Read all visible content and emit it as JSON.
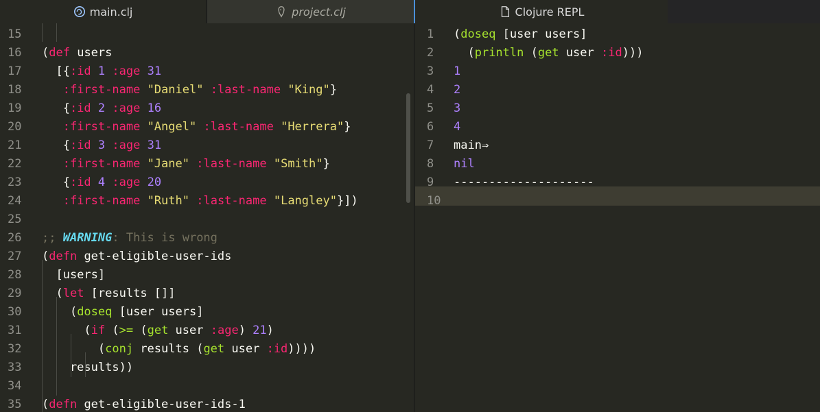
{
  "tabs": {
    "main": "main.clj",
    "project": "project.clj",
    "repl": "Clojure REPL"
  },
  "editor": {
    "lines": [
      {
        "n": "15",
        "tokens": []
      },
      {
        "n": "16",
        "tokens": [
          [
            "p",
            "("
          ],
          [
            "kw",
            "def"
          ],
          [
            "p",
            " users"
          ]
        ]
      },
      {
        "n": "17",
        "tokens": [
          [
            "p",
            "  [{"
          ],
          [
            "kwd",
            ":id"
          ],
          [
            "p",
            " "
          ],
          [
            "num",
            "1"
          ],
          [
            "p",
            " "
          ],
          [
            "kwd",
            ":age"
          ],
          [
            "p",
            " "
          ],
          [
            "num",
            "31"
          ]
        ]
      },
      {
        "n": "18",
        "tokens": [
          [
            "p",
            "   "
          ],
          [
            "kwd",
            ":first-name"
          ],
          [
            "p",
            " "
          ],
          [
            "str",
            "\"Daniel\""
          ],
          [
            "p",
            " "
          ],
          [
            "kwd",
            ":last-name"
          ],
          [
            "p",
            " "
          ],
          [
            "str",
            "\"King\""
          ],
          [
            "p",
            "}"
          ]
        ]
      },
      {
        "n": "19",
        "tokens": [
          [
            "p",
            "   {"
          ],
          [
            "kwd",
            ":id"
          ],
          [
            "p",
            " "
          ],
          [
            "num",
            "2"
          ],
          [
            "p",
            " "
          ],
          [
            "kwd",
            ":age"
          ],
          [
            "p",
            " "
          ],
          [
            "num",
            "16"
          ]
        ]
      },
      {
        "n": "20",
        "tokens": [
          [
            "p",
            "   "
          ],
          [
            "kwd",
            ":first-name"
          ],
          [
            "p",
            " "
          ],
          [
            "str",
            "\"Angel\""
          ],
          [
            "p",
            " "
          ],
          [
            "kwd",
            ":last-name"
          ],
          [
            "p",
            " "
          ],
          [
            "str",
            "\"Herrera\""
          ],
          [
            "p",
            "}"
          ]
        ]
      },
      {
        "n": "21",
        "tokens": [
          [
            "p",
            "   {"
          ],
          [
            "kwd",
            ":id"
          ],
          [
            "p",
            " "
          ],
          [
            "num",
            "3"
          ],
          [
            "p",
            " "
          ],
          [
            "kwd",
            ":age"
          ],
          [
            "p",
            " "
          ],
          [
            "num",
            "31"
          ]
        ]
      },
      {
        "n": "22",
        "tokens": [
          [
            "p",
            "   "
          ],
          [
            "kwd",
            ":first-name"
          ],
          [
            "p",
            " "
          ],
          [
            "str",
            "\"Jane\""
          ],
          [
            "p",
            " "
          ],
          [
            "kwd",
            ":last-name"
          ],
          [
            "p",
            " "
          ],
          [
            "str",
            "\"Smith\""
          ],
          [
            "p",
            "}"
          ]
        ]
      },
      {
        "n": "23",
        "tokens": [
          [
            "p",
            "   {"
          ],
          [
            "kwd",
            ":id"
          ],
          [
            "p",
            " "
          ],
          [
            "num",
            "4"
          ],
          [
            "p",
            " "
          ],
          [
            "kwd",
            ":age"
          ],
          [
            "p",
            " "
          ],
          [
            "num",
            "20"
          ]
        ]
      },
      {
        "n": "24",
        "tokens": [
          [
            "p",
            "   "
          ],
          [
            "kwd",
            ":first-name"
          ],
          [
            "p",
            " "
          ],
          [
            "str",
            "\"Ruth\""
          ],
          [
            "p",
            " "
          ],
          [
            "kwd",
            ":last-name"
          ],
          [
            "p",
            " "
          ],
          [
            "str",
            "\"Langley\""
          ],
          [
            "p",
            "}])"
          ]
        ]
      },
      {
        "n": "25",
        "tokens": []
      },
      {
        "n": "26",
        "tokens": [
          [
            "cmt",
            ";; "
          ],
          [
            "warn",
            "WARNING"
          ],
          [
            "cmt",
            ": This is wrong"
          ]
        ]
      },
      {
        "n": "27",
        "tokens": [
          [
            "p",
            "("
          ],
          [
            "kw",
            "defn"
          ],
          [
            "p",
            " get-eligible-user-ids"
          ]
        ]
      },
      {
        "n": "28",
        "tokens": [
          [
            "p",
            "  [users]"
          ]
        ]
      },
      {
        "n": "29",
        "tokens": [
          [
            "p",
            "  ("
          ],
          [
            "kw",
            "let"
          ],
          [
            "p",
            " [results []]"
          ]
        ]
      },
      {
        "n": "30",
        "tokens": [
          [
            "p",
            "    ("
          ],
          [
            "fn",
            "doseq"
          ],
          [
            "p",
            " [user users]"
          ]
        ]
      },
      {
        "n": "31",
        "tokens": [
          [
            "p",
            "      ("
          ],
          [
            "kw",
            "if"
          ],
          [
            "p",
            " ("
          ],
          [
            "fn",
            ">="
          ],
          [
            "p",
            " ("
          ],
          [
            "fn",
            "get"
          ],
          [
            "p",
            " user "
          ],
          [
            "kwd",
            ":age"
          ],
          [
            "p",
            ") "
          ],
          [
            "num",
            "21"
          ],
          [
            "p",
            ")"
          ]
        ]
      },
      {
        "n": "32",
        "tokens": [
          [
            "p",
            "        ("
          ],
          [
            "fn",
            "conj"
          ],
          [
            "p",
            " results ("
          ],
          [
            "fn",
            "get"
          ],
          [
            "p",
            " user "
          ],
          [
            "kwd",
            ":id"
          ],
          [
            "p",
            "))))"
          ]
        ]
      },
      {
        "n": "33",
        "tokens": [
          [
            "p",
            "    results))"
          ]
        ]
      },
      {
        "n": "34",
        "tokens": []
      },
      {
        "n": "35",
        "tokens": [
          [
            "p",
            "("
          ],
          [
            "kw",
            "defn"
          ],
          [
            "p",
            " get-eligible-user-ids-1"
          ]
        ]
      }
    ]
  },
  "repl": {
    "lines": [
      {
        "n": "1",
        "tokens": [
          [
            "p",
            "("
          ],
          [
            "fn",
            "doseq"
          ],
          [
            "p",
            " [user users]"
          ]
        ]
      },
      {
        "n": "2",
        "tokens": [
          [
            "p",
            "  ("
          ],
          [
            "fn",
            "println"
          ],
          [
            "p",
            " ("
          ],
          [
            "fn",
            "get"
          ],
          [
            "p",
            " user "
          ],
          [
            "kwd",
            ":id"
          ],
          [
            "p",
            ")))"
          ]
        ]
      },
      {
        "n": "3",
        "tokens": [
          [
            "num",
            "1"
          ]
        ]
      },
      {
        "n": "4",
        "tokens": [
          [
            "num",
            "2"
          ]
        ]
      },
      {
        "n": "5",
        "tokens": [
          [
            "num",
            "3"
          ]
        ]
      },
      {
        "n": "6",
        "tokens": [
          [
            "num",
            "4"
          ]
        ]
      },
      {
        "n": "7",
        "tokens": [
          [
            "p",
            "main⇒"
          ]
        ]
      },
      {
        "n": "8",
        "tokens": [
          [
            "num",
            "nil"
          ]
        ]
      },
      {
        "n": "9",
        "tokens": [
          [
            "p",
            "--------------------"
          ]
        ]
      },
      {
        "n": "10",
        "tokens": []
      }
    ]
  },
  "icons": {
    "main_tab": "clojure-logo-icon",
    "project_tab": "leiningen-icon",
    "repl_tab": "file-icon"
  }
}
